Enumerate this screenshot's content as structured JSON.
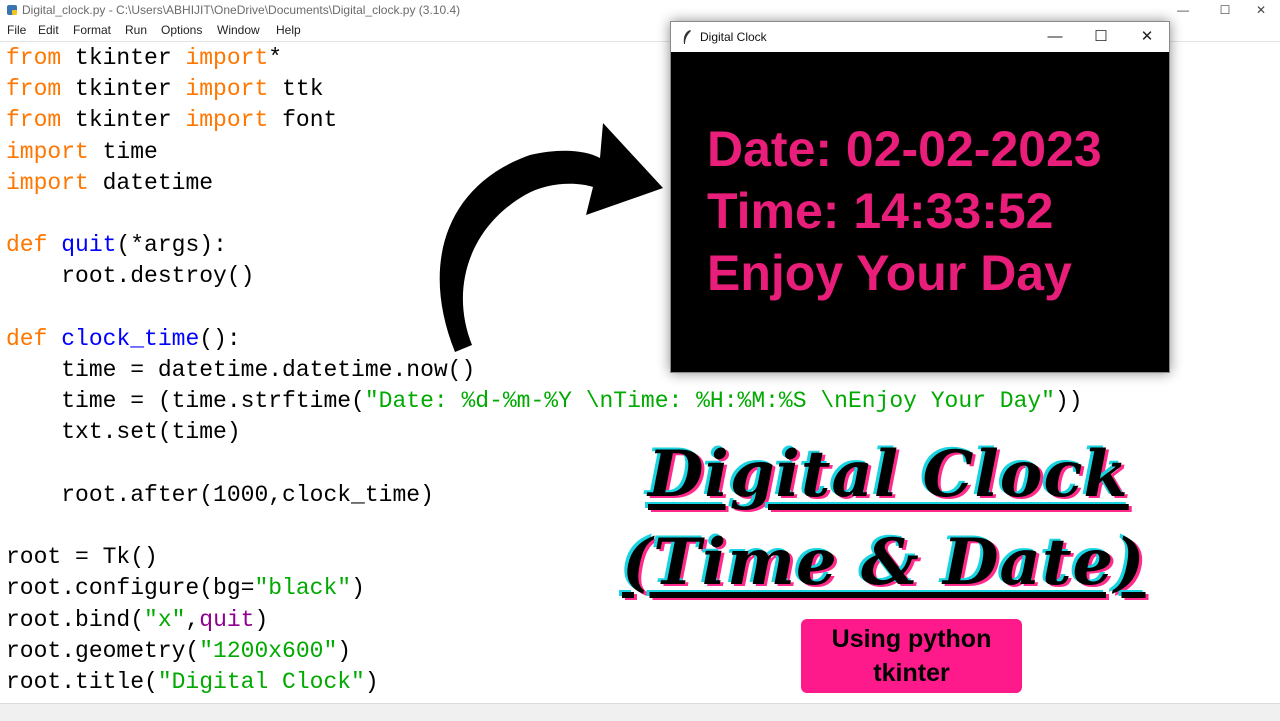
{
  "editor": {
    "window_title": "Digital_clock.py - C:\\Users\\ABHIJIT\\OneDrive\\Documents\\Digital_clock.py (3.10.4)",
    "menu": [
      "File",
      "Edit",
      "Format",
      "Run",
      "Options",
      "Window",
      "Help"
    ],
    "window_controls": {
      "minimize": "—",
      "maximize": "☐",
      "close": "✕"
    }
  },
  "clock_window": {
    "title": "Digital Clock",
    "controls": {
      "minimize": "—",
      "maximize": "☐",
      "close": "✕"
    },
    "date_line": "Date: 02-02-2023",
    "time_line": "Time: 14:33:52",
    "message_line": "Enjoy Your Day",
    "text_color": "#e81e7a",
    "background_color": "#000000"
  },
  "overlay": {
    "title_line1": "Digital Clock",
    "title_line2": "(Time & Date)",
    "badge_line1": "Using python",
    "badge_line2": "tkinter",
    "badge_color": "#ff1a8c"
  },
  "code": {
    "l1_kw1": "from",
    "l1_txt1": " tkinter ",
    "l1_kw2": "import",
    "l1_txt2": "*",
    "l2_kw1": "from",
    "l2_txt1": " tkinter ",
    "l2_kw2": "import",
    "l2_txt2": " ttk",
    "l3_kw1": "from",
    "l3_txt1": " tkinter ",
    "l3_kw2": "import",
    "l3_txt2": " font",
    "l4_kw": "import",
    "l4_txt": " time",
    "l5_kw": "import",
    "l5_txt": " datetime",
    "l7_kw": "def",
    "l7_sp": " ",
    "l7_fn": "quit",
    "l7_txt": "(*args):",
    "l8_txt": "    root.destroy()",
    "l10_kw": "def",
    "l10_sp": " ",
    "l10_fn": "clock_time",
    "l10_txt": "():",
    "l11_txt": "    time = datetime.datetime.now()",
    "l12_txt1": "    time = (time.strftime(",
    "l12_str": "\"Date: %d-%m-%Y \\nTime: %H:%M:%S \\nEnjoy Your Day\"",
    "l12_txt2": "))",
    "l13_txt": "    txt.set(time)",
    "l15_txt": "    root.after(1000,clock_time)",
    "l17_txt": "root = Tk()",
    "l18_txt1": "root.configure(bg=",
    "l18_str": "\"black\"",
    "l18_txt2": ")",
    "l19_txt1": "root.bind(",
    "l19_str": "\"x\"",
    "l19_txt2": ",",
    "l19_bi": "quit",
    "l19_txt3": ")",
    "l20_txt1": "root.geometry(",
    "l20_str": "\"1200x600\"",
    "l20_txt2": ")",
    "l21_txt1": "root.title(",
    "l21_str": "\"Digital Clock\"",
    "l21_txt2": ")"
  }
}
